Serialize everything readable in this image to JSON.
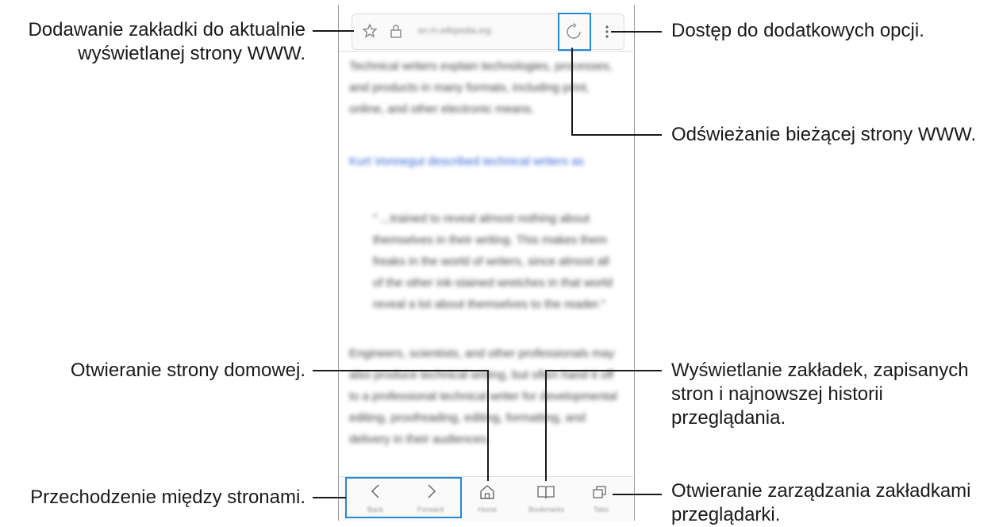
{
  "callouts": {
    "bookmark": "Dodawanie zakładki do aktualnie\nwyświetlanej strony WWW.",
    "options": "Dostęp do dodatkowych opcji.",
    "refresh": "Odświeżanie bieżącej strony WWW.",
    "home": "Otwieranie strony domowej.",
    "bookmarks_view": "Wyświetlanie zakładek, zapisanych\nstron i najnowszej historii\nprzeglądania.",
    "navigate": "Przechodzenie między stronami.",
    "tabs": "Otwieranie zarządzania zakładkami\nprzeglądarki."
  },
  "browser": {
    "url": "en.m.wikipedia.org",
    "content_paragraphs": [
      "Technical writers explain technologies, processes, and products in many formats, including print, online, and other electronic means.",
      "Kurt Vonnegut described technical writers as",
      "\" ...trained to reveal almost nothing about themselves in their writing. This makes them freaks in the world of writers, since almost all of the other ink-stained wretches in that world reveal a lot about themselves to the reader.\"",
      "Engineers, scientists, and other professionals may also produce technical writing, but often hand it off to a professional technical writer for developmental editing, proofreading, editing, formatting, and delivery in their audiences."
    ],
    "bottom_labels": {
      "back": "Back",
      "forward": "Forward",
      "home": "Home",
      "bookmarks": "Bookmarks",
      "tabs": "Tabs"
    }
  },
  "icons": {
    "star": "star-icon",
    "lock": "lock-icon",
    "refresh": "refresh-icon",
    "more": "more-vertical-icon",
    "back": "chevron-left-icon",
    "forward": "chevron-right-icon",
    "home": "home-icon",
    "bookmarks": "book-icon",
    "tabs": "tabs-icon"
  },
  "colors": {
    "highlight": "#1f8ad8",
    "link": "#2f63d6"
  }
}
